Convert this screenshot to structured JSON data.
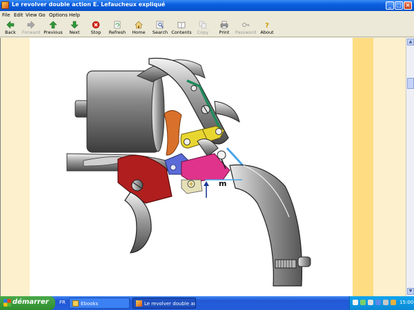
{
  "window": {
    "title": "Le revolver double action E. Lefaucheux expliqué",
    "minimize": "_",
    "maximize": "□",
    "close": "×"
  },
  "menu": [
    "File",
    "Edit",
    "View",
    "Go",
    "Options",
    "Help"
  ],
  "toolbar": {
    "back": "Back",
    "forward": "Forward",
    "previous": "Previous",
    "next": "Next",
    "stop": "Stop",
    "refresh": "Refresh",
    "home": "Home",
    "search": "Search",
    "contents": "Contents",
    "copy": "Copy",
    "print": "Print",
    "password": "Password",
    "about": "About"
  },
  "diagram": {
    "label": "m"
  },
  "scrollbar": {
    "up": "▲",
    "down": "▼"
  },
  "taskbar": {
    "start": "démarrer",
    "lang": "FR",
    "tasks": [
      "Ebooks",
      "Le revolver double ac..."
    ],
    "clock": "15:00"
  },
  "colors": {
    "titlebar": "#0a5fe0",
    "taskbar": "#245edb",
    "start": "#2f8e2f",
    "page_margin": "#fdf0cc",
    "page_band": "#fddc82"
  }
}
